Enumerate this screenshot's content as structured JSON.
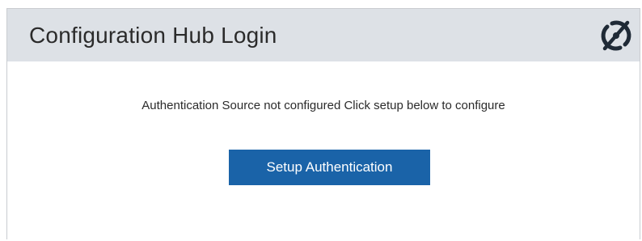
{
  "header": {
    "title": "Configuration Hub Login",
    "logo_icon": "ge-digital-logo-icon"
  },
  "main": {
    "message": "Authentication Source not configured Click setup below to configure",
    "setup_button_label": "Setup Authentication"
  },
  "colors": {
    "header_background": "#dde1e6",
    "button_background": "#1a63a8",
    "button_text": "#ffffff",
    "text": "#2b2b2b"
  }
}
